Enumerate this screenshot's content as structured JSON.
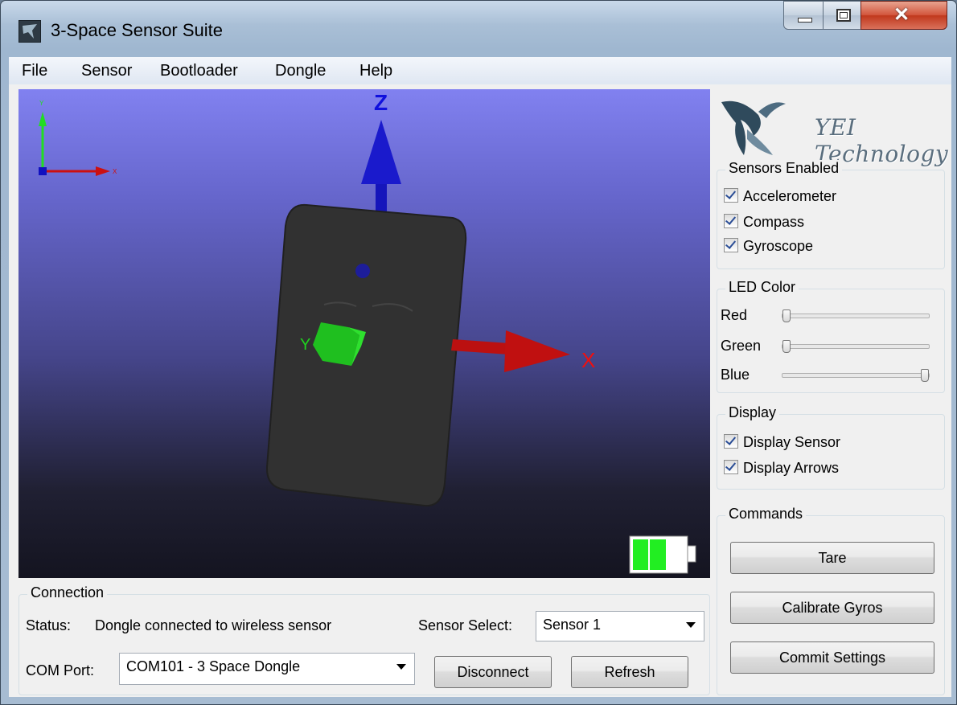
{
  "window": {
    "title": "3-Space Sensor Suite"
  },
  "menu": [
    "File",
    "Sensor",
    "Bootloader",
    "Dongle",
    "Help"
  ],
  "viewport": {
    "gizmo_y": "Y",
    "gizmo_x": "X",
    "axis_z": "Z",
    "axis_x": "X",
    "axis_y": "Y",
    "battery_level": 0.67
  },
  "logo": {
    "text": "YEI Technology"
  },
  "sensors": {
    "title": "Sensors Enabled",
    "items": [
      {
        "label": "Accelerometer",
        "checked": true
      },
      {
        "label": "Compass",
        "checked": true
      },
      {
        "label": "Gyroscope",
        "checked": true
      }
    ]
  },
  "led": {
    "title": "LED Color",
    "red_label": "Red",
    "green_label": "Green",
    "blue_label": "Blue",
    "red": 0,
    "green": 0,
    "blue": 1
  },
  "display": {
    "title": "Display",
    "items": [
      {
        "label": "Display Sensor",
        "checked": true
      },
      {
        "label": "Display Arrows",
        "checked": true
      }
    ]
  },
  "commands": {
    "title": "Commands",
    "tare": "Tare",
    "calibrate": "Calibrate Gyros",
    "commit": "Commit Settings"
  },
  "connection": {
    "title": "Connection",
    "status_label": "Status:",
    "status_value": "Dongle connected to wireless sensor",
    "sensor_select_label": "Sensor Select:",
    "sensor_select_value": "Sensor 1",
    "com_port_label": "COM Port:",
    "com_port_value": "COM101 - 3 Space Dongle",
    "disconnect": "Disconnect",
    "refresh": "Refresh"
  },
  "colors": {
    "accent": "#2a4d96",
    "axis_x": "#d10000",
    "axis_y": "#1fd11f",
    "axis_z": "#1010c8",
    "battery": "#22ee22"
  }
}
